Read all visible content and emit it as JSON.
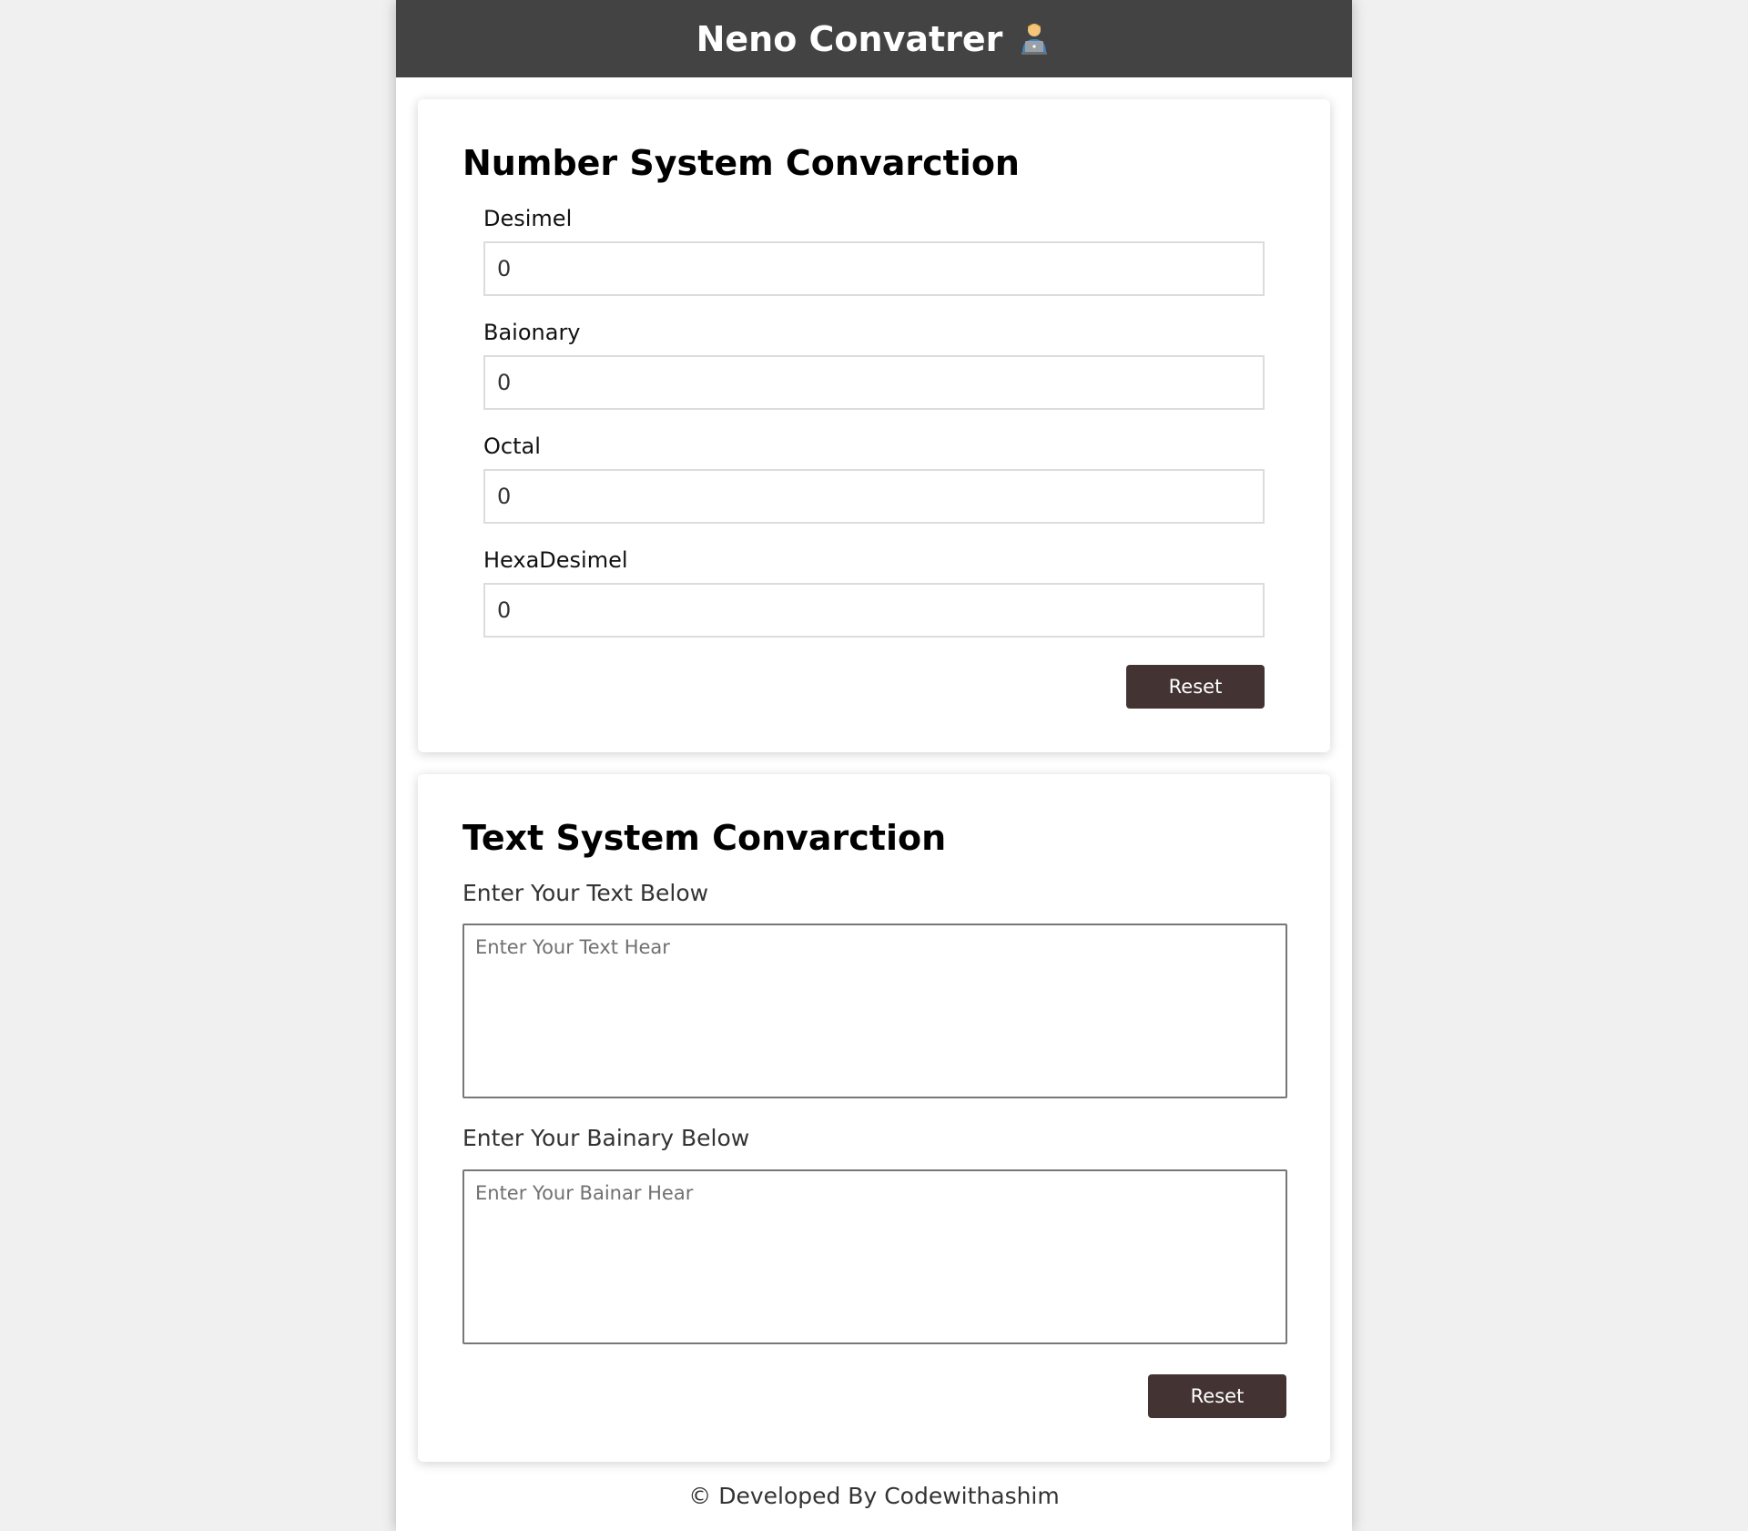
{
  "header": {
    "title": "Neno Convatrer",
    "icon": "technologist-icon"
  },
  "number_section": {
    "title": "Number System Convarction",
    "fields": [
      {
        "label": "Desimel",
        "value": "0"
      },
      {
        "label": "Baionary",
        "value": "0"
      },
      {
        "label": "Octal",
        "value": "0"
      },
      {
        "label": "HexaDesimel",
        "value": "0"
      }
    ],
    "reset_label": "Reset"
  },
  "text_section": {
    "title": "Text System Convarction",
    "text_label": "Enter Your Text Below",
    "text_placeholder": "Enter Your Text Hear",
    "binary_label": "Enter Your Bainary Below",
    "binary_placeholder": "Enter Your Bainar Hear",
    "reset_label": "Reset"
  },
  "footer": {
    "text": "© Developed By Codewithashim"
  },
  "colors": {
    "header_bg": "#434343",
    "button_bg": "#443333",
    "page_bg": "#f0f0f0"
  }
}
